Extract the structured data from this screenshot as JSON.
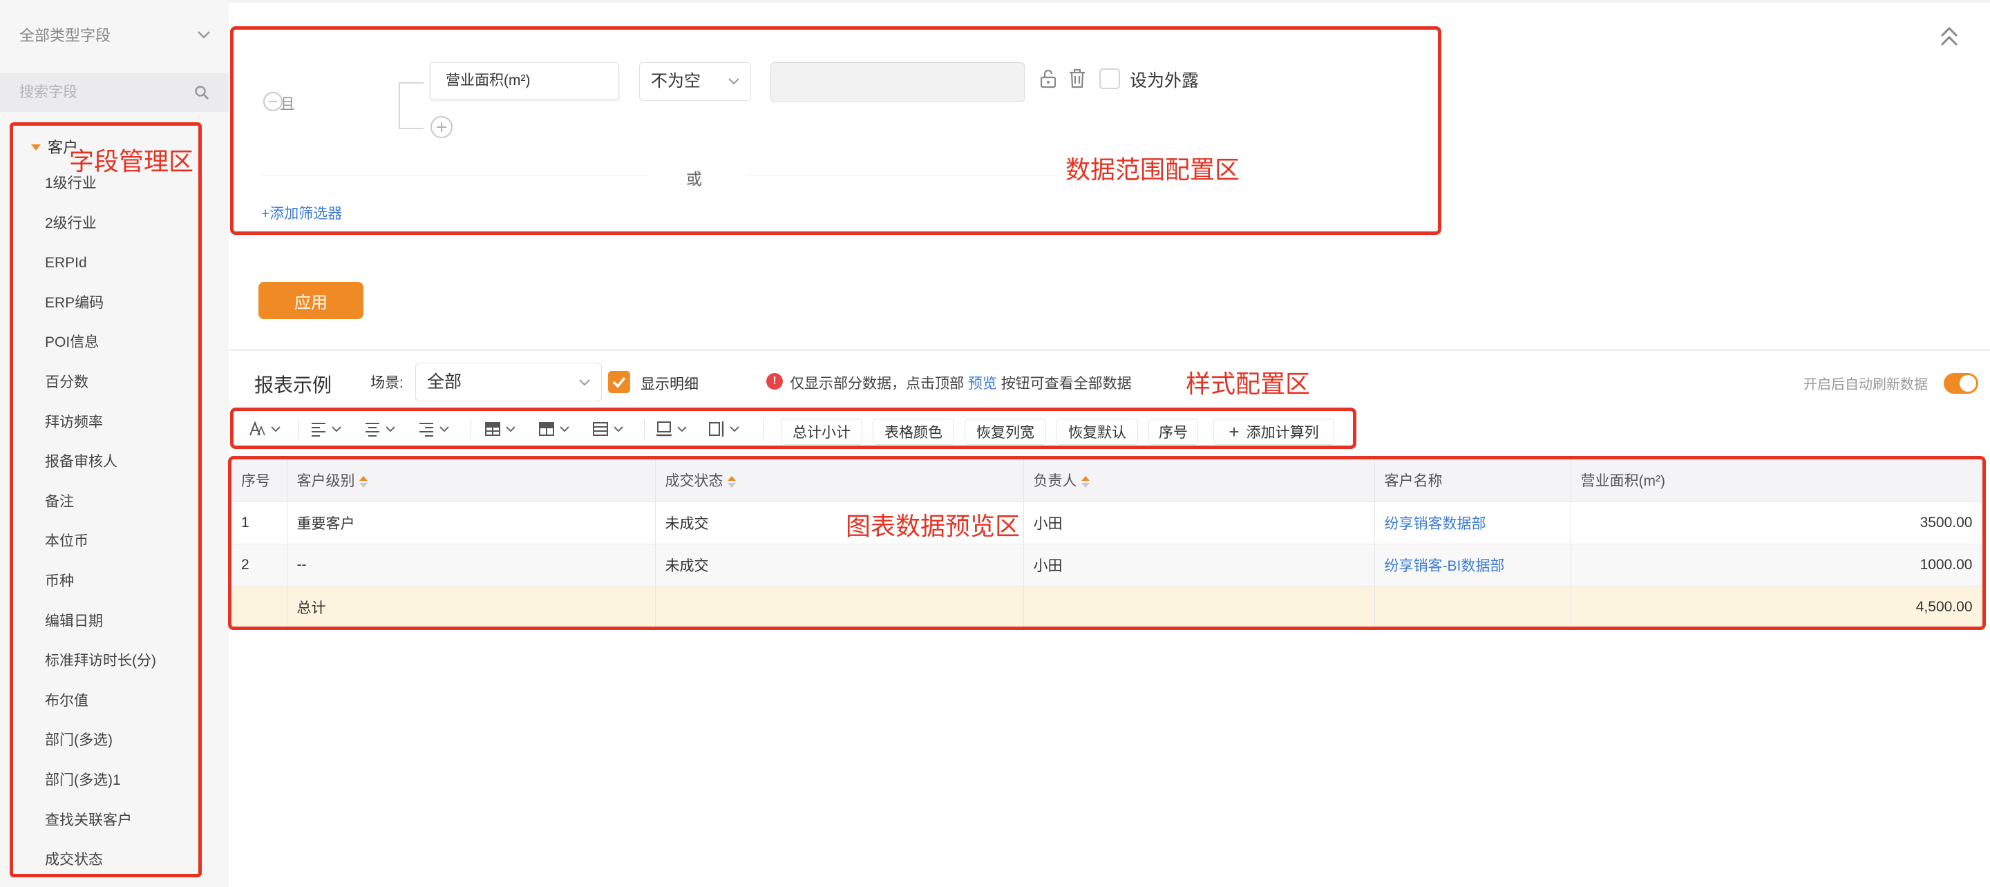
{
  "sidebar": {
    "type_filter": "全部类型字段",
    "search_placeholder": "搜索字段",
    "group": "客户",
    "fields": [
      "1级行业",
      "2级行业",
      "ERPId",
      "ERP编码",
      "POI信息",
      "百分数",
      "拜访频率",
      "报备审核人",
      "备注",
      "本位币",
      "币种",
      "编辑日期",
      "标准拜访时长(分)",
      "布尔值",
      "部门(多选)",
      "部门(多选)1",
      "查找关联客户",
      "成交状态"
    ]
  },
  "annotations": {
    "field_area": "字段管理区",
    "filter_area": "数据范围配置区",
    "style_area": "样式配置区",
    "preview_area": "图表数据预览区"
  },
  "filter": {
    "and_label": "且",
    "field": "营业面积(m²)",
    "operator": "不为空",
    "value": "",
    "expose_label": "设为外露",
    "or_label": "或",
    "add_filter": "+添加筛选器"
  },
  "apply_label": "应用",
  "report": {
    "title": "报表示例",
    "scene_label": "场景:",
    "scene_value": "全部",
    "show_detail_label": "显示明细",
    "notice_prefix": "仅显示部分数据，点击顶部",
    "notice_link": "预览",
    "notice_suffix": "按钮可查看全部数据",
    "auto_refresh_label": "开启后自动刷新数据"
  },
  "toolbar": {
    "buttons": [
      "总计小计",
      "表格颜色",
      "恢复列宽",
      "恢复默认",
      "序号",
      "添加计算列"
    ]
  },
  "table": {
    "headers": [
      "序号",
      "客户级别",
      "成交状态",
      "负责人",
      "客户名称",
      "营业面积(m²)"
    ],
    "rows": [
      [
        "1",
        "重要客户",
        "未成交",
        "小田",
        "纷享销客数据部",
        "3500.00"
      ],
      [
        "2",
        "--",
        "未成交",
        "小田",
        "纷享销客-BI数据部",
        "1000.00"
      ]
    ],
    "total": {
      "label": "总计",
      "value": "4,500.00"
    }
  },
  "colors": {
    "accent": "#f08a24",
    "annotation": "#e53323",
    "link": "#3a7bd5",
    "total_row": "#fdf4df"
  }
}
